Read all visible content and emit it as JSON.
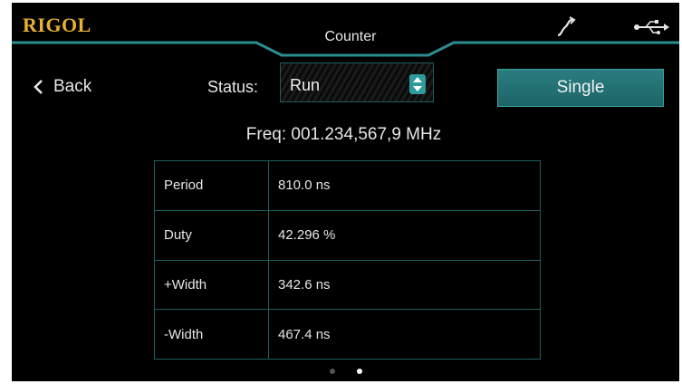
{
  "app": {
    "brand": "RIGOL",
    "title": "Counter"
  },
  "nav": {
    "back_label": "Back"
  },
  "status": {
    "label": "Status:",
    "value": "Run"
  },
  "single_button": {
    "label": "Single"
  },
  "frequency": {
    "text": "Freq: 001.234,567,9 MHz"
  },
  "measurements": [
    {
      "label": "Period",
      "value": "810.0 ns"
    },
    {
      "label": "Duty",
      "value": "42.296 %"
    },
    {
      "label": "+Width",
      "value": "342.6 ns"
    },
    {
      "label": "-Width",
      "value": "467.4 ns"
    }
  ],
  "pagination": {
    "page_count": 2,
    "current_page": 2
  },
  "colors": {
    "brand": "#e8b230",
    "accent": "#2a7d80",
    "border": "#1f5d60",
    "background": "#000000"
  },
  "icons": {
    "signal": "signal-icon",
    "usb": "usb-icon",
    "back": "chevron-left-icon",
    "spin": "up-down-spin-icon"
  }
}
